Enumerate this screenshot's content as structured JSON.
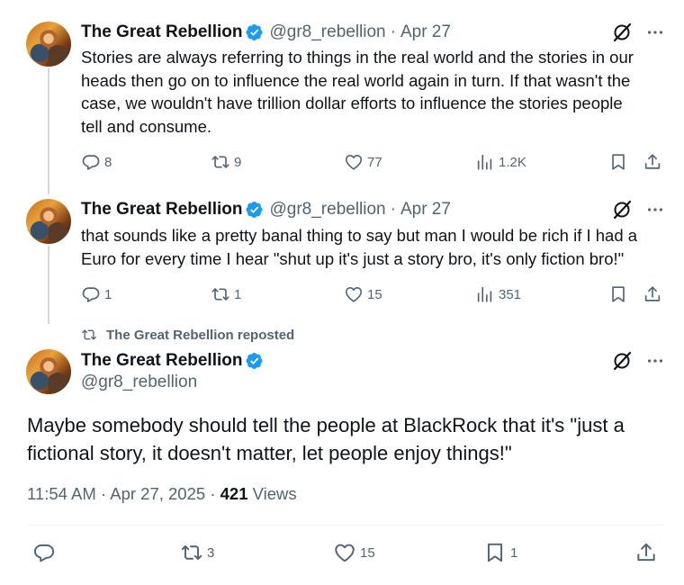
{
  "tweets": [
    {
      "name": "The Great Rebellion",
      "handle": "@gr8_rebellion",
      "date": "Apr 27",
      "lines": [
        "Stories are always referring to things in the real world and the stories in our",
        "heads then go on to influence the real world again in turn. If that wasn't the",
        "case, we wouldn't have trillion dollar efforts to influence the stories people",
        "tell and consume."
      ],
      "replies": "8",
      "reposts": "9",
      "likes": "77",
      "views": "1.2K"
    },
    {
      "name": "The Great Rebellion",
      "handle": "@gr8_rebellion",
      "date": "Apr 27",
      "lines": [
        "that sounds like a pretty banal thing to say but man I would be rich if I had a",
        "Euro for every time I hear \"shut up it's just a story bro, it's only fiction bro!\""
      ],
      "replies": "1",
      "reposts": "1",
      "likes": "15",
      "views": "351"
    }
  ],
  "repost_banner": "The Great Rebellion reposted",
  "main": {
    "name": "The Great Rebellion",
    "handle": "@gr8_rebellion",
    "lines": [
      "Maybe somebody should tell the people at BlackRock that it's \"just a",
      "fictional story, it doesn't matter, let people enjoy things!\""
    ],
    "time": "11:54 AM",
    "date": "Apr 27, 2025",
    "views_count": "421",
    "views_label": "Views",
    "reposts": "3",
    "likes": "15",
    "bookmarks": "1"
  },
  "separator": "·",
  "icons": [
    "verified-badge-icon",
    "grok-icon",
    "more-icon",
    "reply-icon",
    "repost-icon",
    "like-icon",
    "views-icon",
    "bookmark-icon",
    "share-icon"
  ],
  "colors": {
    "verified": "#1d9bf0",
    "text": "#0f1419",
    "secondary": "#536471",
    "line": "#cfd9de"
  }
}
